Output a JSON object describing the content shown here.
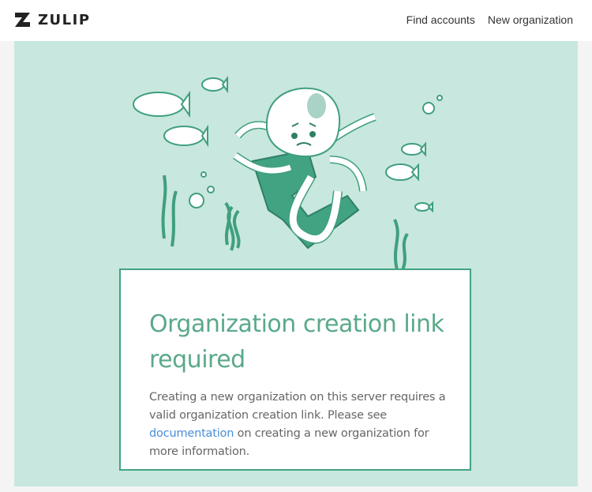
{
  "header": {
    "logo_text": "ZULIP",
    "nav": {
      "find_accounts": "Find accounts",
      "new_organization": "New organization"
    }
  },
  "card": {
    "title": "Organization creation link required",
    "body_before_link": "Creating a new organization on this server requires a valid organization creation link. Please see ",
    "link_text": "documentation",
    "body_after_link": " on creating a new organization for more information."
  },
  "colors": {
    "hero_bg": "#c8e7de",
    "accent": "#42a383",
    "title": "#5aa98a",
    "link": "#4a8ed8"
  }
}
